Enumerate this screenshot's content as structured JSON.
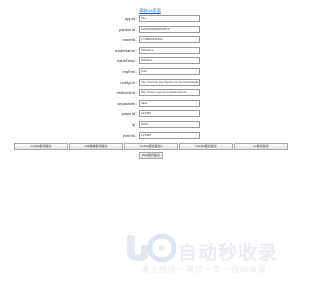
{
  "header": {
    "title_link": "获取UA页面"
  },
  "form": {
    "fields": [
      {
        "label": "appId：",
        "value": "151"
      },
      {
        "label": "partnerId：",
        "value": "10001000000001010"
      },
      {
        "label": "tradeId：",
        "value": "1749962201462"
      },
      {
        "label": "tradeName：",
        "value": "100name"
      },
      {
        "label": "tradeDesc：",
        "value": "100desc"
      },
      {
        "label": "reqFee：",
        "value": "0.02"
      },
      {
        "label": "notifyUrl：",
        "value": "http://service.pay.5jqdpt.com/serviceHandler"
      },
      {
        "label": "redirectUrl：",
        "value": "http://www.xayouxi.cn/paxinw.html"
      },
      {
        "label": "separable：",
        "value": "false"
      },
      {
        "label": "payerId：",
        "value": "123456"
      },
      {
        "label": "ip：",
        "value": "1000"
      },
      {
        "label": "extInfo：",
        "value": "123456"
      }
    ]
  },
  "actions": {
    "buttons": [
      {
        "label": "mobile模式提交"
      },
      {
        "label": "sdk微信模式提交"
      },
      {
        "label": "mobile模式提交2"
      },
      {
        "label": "scantel模式提交"
      },
      {
        "label": "pc模式提交"
      }
    ],
    "extra_button": "Web模式提交"
  },
  "watermark": {
    "brand": "自动秒收录",
    "tagline": "做上抢排一来访一次一自动收录"
  },
  "colors": {
    "link": "#1a5fd0",
    "input_border": "#9a9a9a",
    "watermark": "#e9ecf2"
  }
}
